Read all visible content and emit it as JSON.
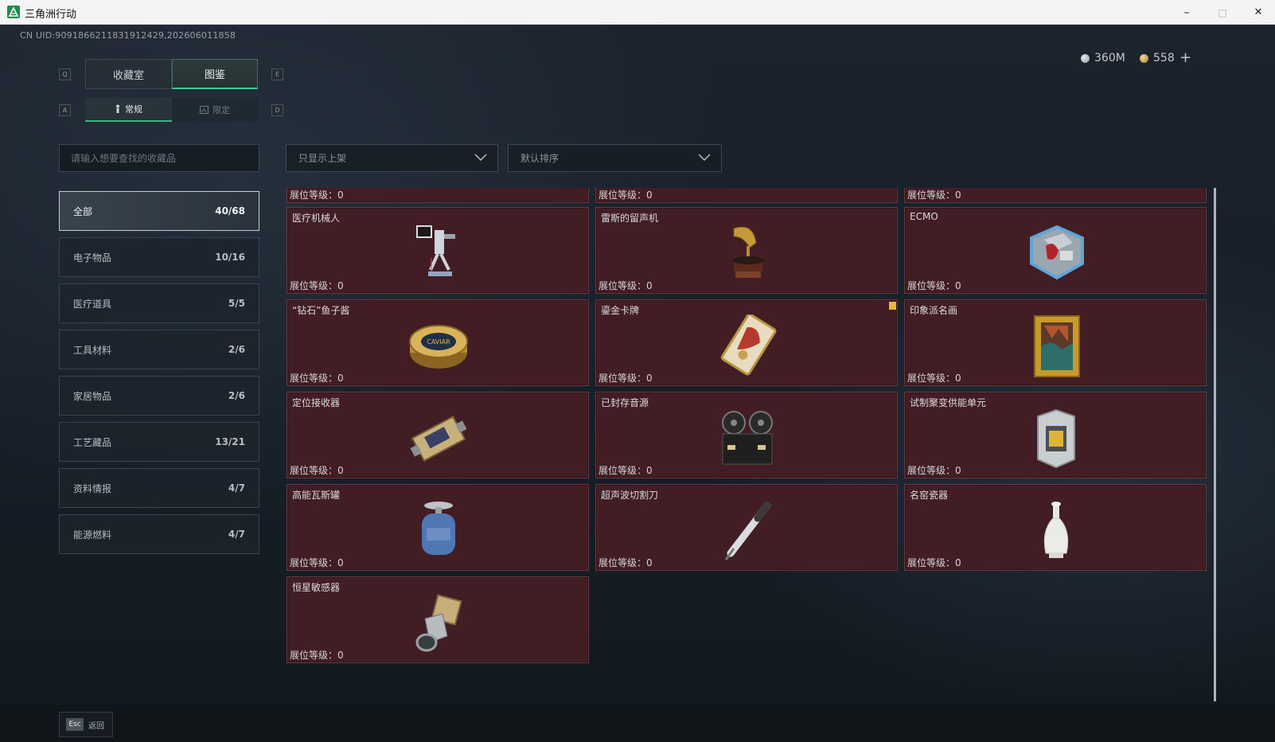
{
  "window": {
    "title": "三角洲行动",
    "minimize": "–",
    "maximize": "□",
    "close": "✕"
  },
  "uid": "CN UID:9091866211831912429,202606011858",
  "currency": [
    {
      "icon": "silver-coin-icon",
      "value": "360M",
      "color": "#bfc4c8"
    },
    {
      "icon": "gold-coin-icon",
      "value": "558",
      "color": "#c7a35a"
    }
  ],
  "currency_add": "+",
  "tabs": {
    "key_left": "Q",
    "key_right": "E",
    "items": [
      {
        "label": "收藏室"
      },
      {
        "label": "图鉴"
      }
    ]
  },
  "subtabs": {
    "key_left": "A",
    "key_right": "D",
    "items": [
      {
        "label": "常规",
        "icon": "figure-icon"
      },
      {
        "label": "限定",
        "icon": "frame-icon"
      }
    ]
  },
  "search": {
    "placeholder": "请输入想要查找的收藏品",
    "value": ""
  },
  "filters": {
    "shelf": "只显示上架",
    "sort": "默认排序"
  },
  "categories": [
    {
      "label": "全部",
      "count": "40/68"
    },
    {
      "label": "电子物品",
      "count": "10/16"
    },
    {
      "label": "医疗道具",
      "count": "5/5"
    },
    {
      "label": "工具材料",
      "count": "2/6"
    },
    {
      "label": "家居物品",
      "count": "2/6"
    },
    {
      "label": "工艺藏品",
      "count": "13/21"
    },
    {
      "label": "资料情报",
      "count": "4/7"
    },
    {
      "label": "能源燃料",
      "count": "4/7"
    }
  ],
  "level_label": "展位等级：",
  "items": [
    {
      "name": "",
      "level": "0"
    },
    {
      "name": "",
      "level": "0"
    },
    {
      "name": "",
      "level": "0"
    },
    {
      "name": "医疗机械人",
      "level": "0",
      "icon": "robot-icon"
    },
    {
      "name": "雷斯的留声机",
      "level": "0",
      "icon": "gramophone-icon"
    },
    {
      "name": "ECMO",
      "level": "0",
      "icon": "ecmo-icon"
    },
    {
      "name": "“钻石”鱼子酱",
      "level": "0",
      "icon": "caviar-tin-icon",
      "label": "CAVIAR"
    },
    {
      "name": "鎏金卡牌",
      "level": "0",
      "icon": "gold-card-icon",
      "badge": true
    },
    {
      "name": "印象派名画",
      "level": "0",
      "icon": "painting-icon"
    },
    {
      "name": "定位接收器",
      "level": "0",
      "icon": "receiver-icon"
    },
    {
      "name": "已封存音源",
      "level": "0",
      "icon": "tape-recorder-icon"
    },
    {
      "name": "试制聚变供能单元",
      "level": "0",
      "icon": "fusion-cell-icon"
    },
    {
      "name": "高能瓦斯罐",
      "level": "0",
      "icon": "gas-tank-icon"
    },
    {
      "name": "超声波切割刀",
      "level": "0",
      "icon": "cutter-icon"
    },
    {
      "name": "名窑瓷器",
      "level": "0",
      "icon": "porcelain-vase-icon"
    },
    {
      "name": "恒星敏感器",
      "level": "0",
      "icon": "star-sensor-icon"
    }
  ],
  "footer": {
    "key": "Esc",
    "label": "返回"
  }
}
